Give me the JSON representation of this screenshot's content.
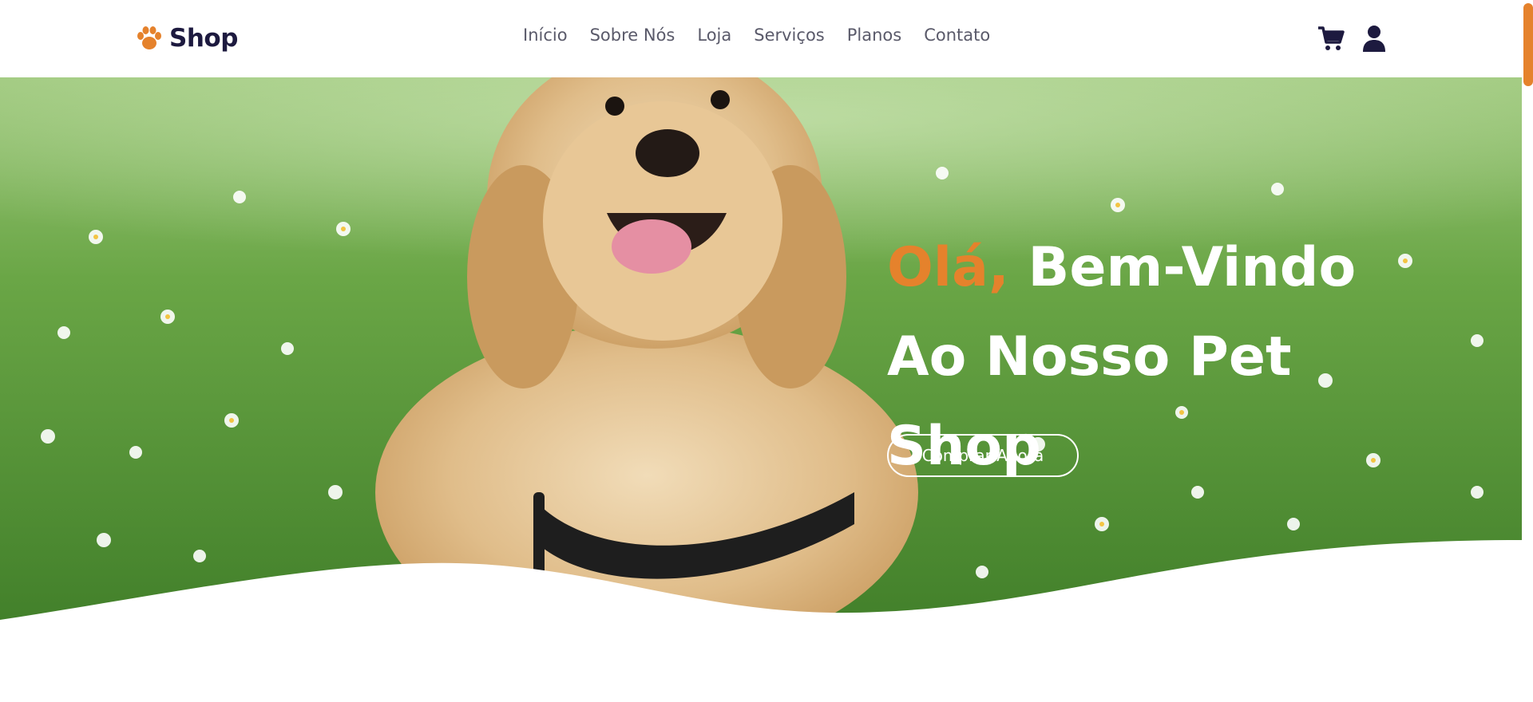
{
  "brand": {
    "name": "Shop",
    "logo_icon": "paw-icon",
    "accent_color": "#e5822c",
    "dark_color": "#1d1a3f"
  },
  "nav": {
    "items": [
      {
        "label": "Início"
      },
      {
        "label": "Sobre Nós"
      },
      {
        "label": "Loja"
      },
      {
        "label": "Serviços"
      },
      {
        "label": "Planos"
      },
      {
        "label": "Contato"
      }
    ]
  },
  "header_icons": {
    "cart": "shopping-cart-icon",
    "user": "user-icon"
  },
  "hero": {
    "greeting": "Olá,",
    "title_line1": "Bem-Vindo",
    "title_line2": "Ao Nosso Pet",
    "title_line3": "Shop",
    "cta_label": "Comprar Agora"
  }
}
